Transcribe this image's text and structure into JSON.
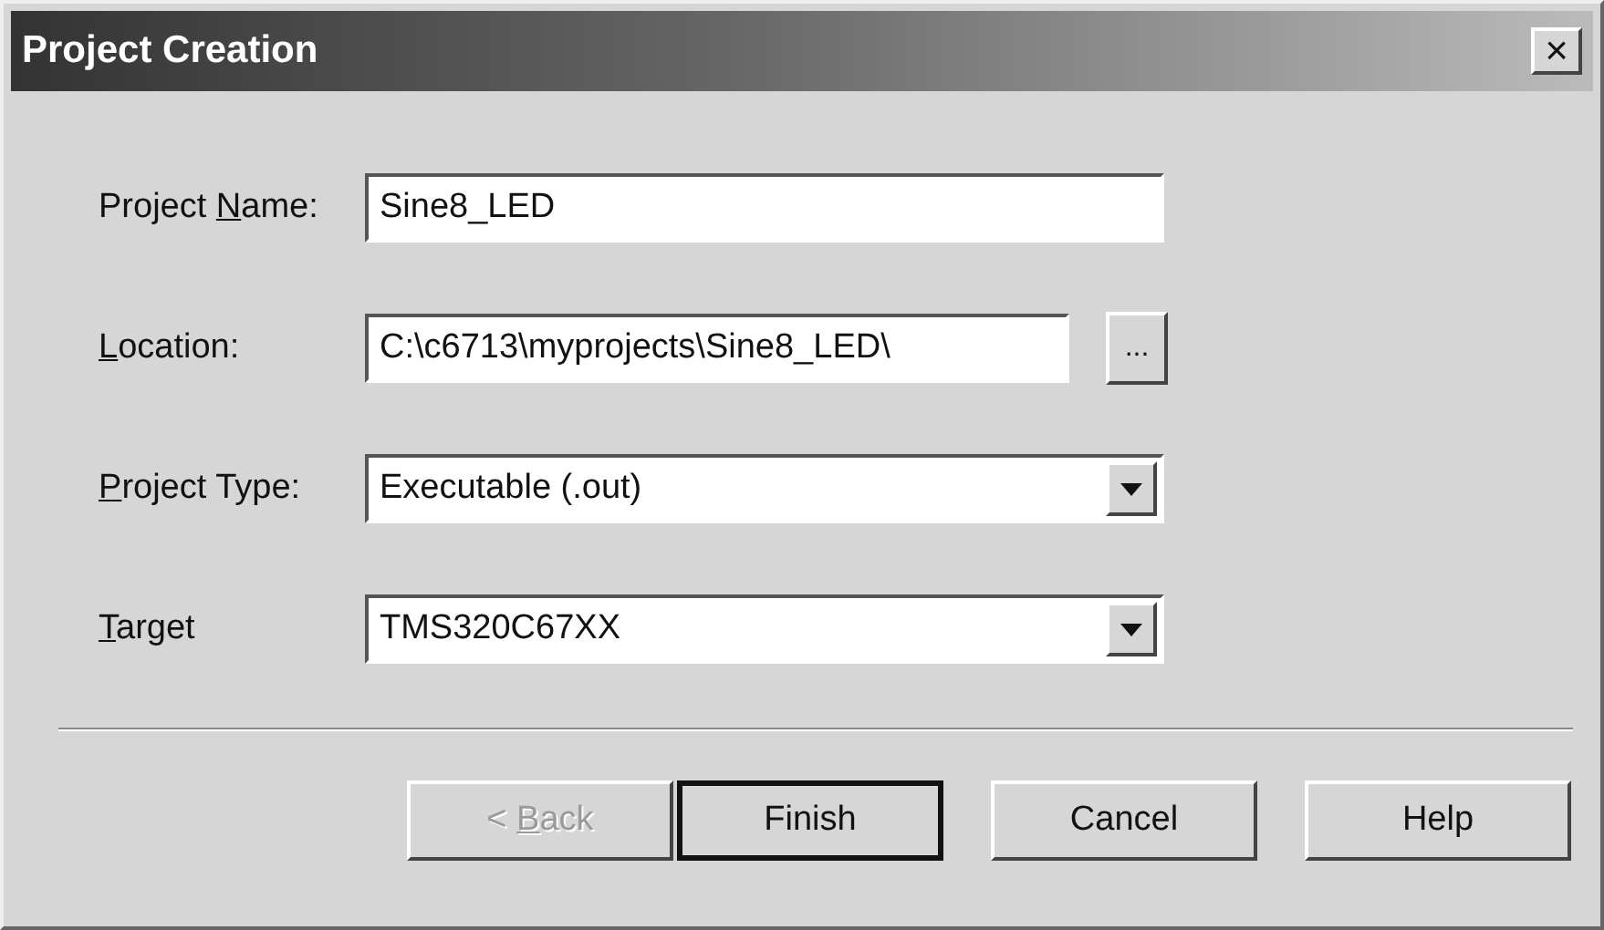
{
  "window": {
    "title": "Project Creation",
    "close": "×"
  },
  "fields": [
    {
      "kind": "text",
      "label": [
        {
          "text": "Project ",
          "underline": false
        },
        {
          "text": "N",
          "underline": true
        },
        {
          "text": "ame:",
          "underline": false
        }
      ],
      "value": "Sine8_LED"
    },
    {
      "kind": "browse",
      "label": [
        {
          "text": "L",
          "underline": true
        },
        {
          "text": "ocation:",
          "underline": false
        }
      ],
      "value": "C:\\c6713\\myprojects\\Sine8_LED\\",
      "button": "..."
    },
    {
      "kind": "dropdown",
      "label": [
        {
          "text": "P",
          "underline": true
        },
        {
          "text": "roject Type:",
          "underline": false
        }
      ],
      "value": "Executable (.out)"
    },
    {
      "kind": "dropdown",
      "label": [
        {
          "text": "T",
          "underline": true
        },
        {
          "text": "arget",
          "underline": false
        }
      ],
      "value": "TMS320C67XX"
    }
  ],
  "buttons": [
    {
      "label": [
        {
          "text": "< ",
          "underline": false
        },
        {
          "text": "B",
          "underline": true
        },
        {
          "text": "ack",
          "underline": false
        }
      ],
      "disabled": true,
      "default": false
    },
    {
      "label": [
        {
          "text": "Finish",
          "underline": false
        }
      ],
      "disabled": false,
      "default": true
    },
    {
      "label": [
        {
          "text": "Cancel",
          "underline": false
        }
      ],
      "disabled": false,
      "default": false
    },
    {
      "label": [
        {
          "text": "Help",
          "underline": false
        }
      ],
      "disabled": false,
      "default": false
    }
  ]
}
